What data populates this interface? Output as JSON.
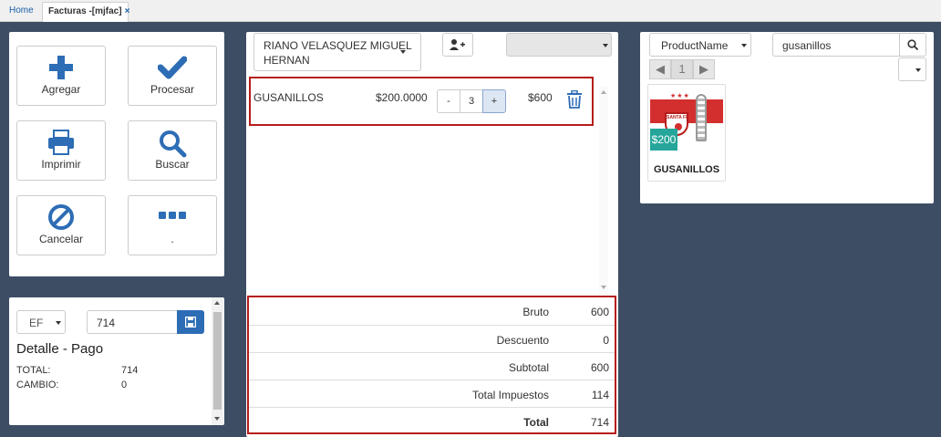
{
  "tabs": {
    "home": "Home",
    "active": "Facturas -[mjfac]",
    "close": "×"
  },
  "actions": {
    "agregar": "Agregar",
    "procesar": "Procesar",
    "imprimir": "Imprimir",
    "buscar": "Buscar",
    "cancelar": "Cancelar",
    "more": "."
  },
  "payment": {
    "method": "EF",
    "amount": "714",
    "title": "Detalle - Pago",
    "total_label": "TOTAL:",
    "total_value": "714",
    "change_label": "CAMBIO:",
    "change_value": "0"
  },
  "invoice": {
    "customer_line1": "RIANO VELASQUEZ MIGUEL",
    "customer_line2": "HERNAN",
    "warehouse": "",
    "items": [
      {
        "name": "GUSANILLOS",
        "price": "$200.0000",
        "minus": "-",
        "qty": "3",
        "plus": "+",
        "amount": "$600"
      }
    ],
    "totals": [
      {
        "label": "Bruto",
        "value": "600"
      },
      {
        "label": "Descuento",
        "value": "0"
      },
      {
        "label": "Subtotal",
        "value": "600"
      },
      {
        "label": "Total Impuestos",
        "value": "114"
      },
      {
        "label": "Total",
        "value": "714"
      }
    ]
  },
  "products": {
    "filter_field": "ProductName",
    "search_value": "gusanillos",
    "page": "1",
    "prev": "◀",
    "next": "▶",
    "cards": [
      {
        "name": "GUSANILLOS",
        "price": "$200",
        "logo_text": "SANTA FE"
      }
    ]
  },
  "colors": {
    "primary": "#2d6db5",
    "highlight_border": "#b71c1c",
    "background": "#3d4d63",
    "price_badge": "#26a69a",
    "logo_red": "#d32f2f"
  },
  "icons": {
    "agregar": "plus-icon",
    "procesar": "check-icon",
    "imprimir": "printer-icon",
    "buscar": "magnifier-icon",
    "cancelar": "ban-icon",
    "more": "ellipsis-icon",
    "save": "floppy-icon",
    "add_customer": "user-plus-icon",
    "delete": "trash-icon",
    "search": "search-icon"
  }
}
